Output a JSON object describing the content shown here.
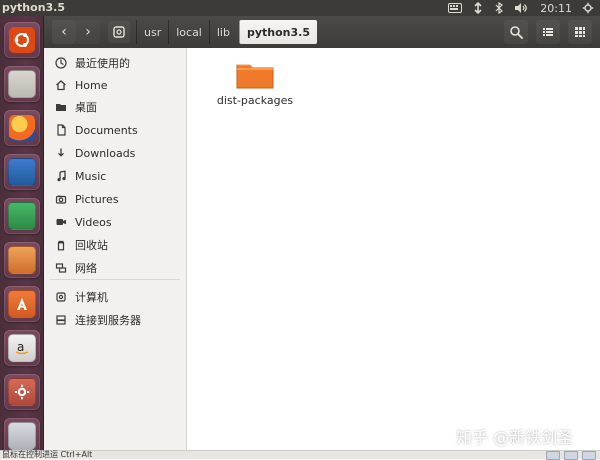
{
  "top_panel": {
    "window_title": "python3.5",
    "clock": "20:11",
    "icons": [
      "keyboard-icon",
      "network-icon",
      "bluetooth-icon",
      "volume-icon",
      "settings-icon"
    ]
  },
  "launcher": {
    "items": [
      {
        "name": "ubuntu-dash",
        "color": "#dd4814"
      },
      {
        "name": "files",
        "color": "#c7c4be"
      },
      {
        "name": "firefox",
        "color": "#f36b21"
      },
      {
        "name": "writer",
        "color": "#2a6bb3"
      },
      {
        "name": "calc",
        "color": "#2d9b4a"
      },
      {
        "name": "impress",
        "color": "#d87a2e"
      },
      {
        "name": "software-center",
        "color": "#e06a2c"
      },
      {
        "name": "amazon",
        "color": "#d9d9d9"
      },
      {
        "name": "system-settings",
        "color": "#c95a4a"
      },
      {
        "name": "trash",
        "color": "#bfc2c7"
      }
    ]
  },
  "toolbar": {
    "path": [
      "usr",
      "local",
      "lib"
    ],
    "current": "python3.5",
    "buttons": {
      "back": "‹",
      "forward": "›",
      "search": "search-icon",
      "list_view": "list-view-icon",
      "grid_view": "grid-view-icon"
    }
  },
  "sidebar": {
    "items": [
      {
        "label": "最近使用的",
        "icon": "clock-icon"
      },
      {
        "label": "Home",
        "icon": "home-icon"
      },
      {
        "label": "桌面",
        "icon": "folder-icon"
      },
      {
        "label": "Documents",
        "icon": "document-icon"
      },
      {
        "label": "Downloads",
        "icon": "download-icon"
      },
      {
        "label": "Music",
        "icon": "music-icon"
      },
      {
        "label": "Pictures",
        "icon": "camera-icon"
      },
      {
        "label": "Videos",
        "icon": "video-icon"
      },
      {
        "label": "回收站",
        "icon": "trash-icon"
      },
      {
        "label": "网络",
        "icon": "network-icon"
      },
      {
        "label": "计算机",
        "icon": "drive-icon"
      },
      {
        "label": "连接到服务器",
        "icon": "server-icon"
      }
    ]
  },
  "main": {
    "files": [
      {
        "name": "dist-packages",
        "type": "folder",
        "color": "#f07a2c"
      }
    ]
  },
  "watermark": "知乎 @新铁剑圣",
  "bottom_strip": {
    "text": "鼠标在控制进运 Ctrl+Alt"
  }
}
